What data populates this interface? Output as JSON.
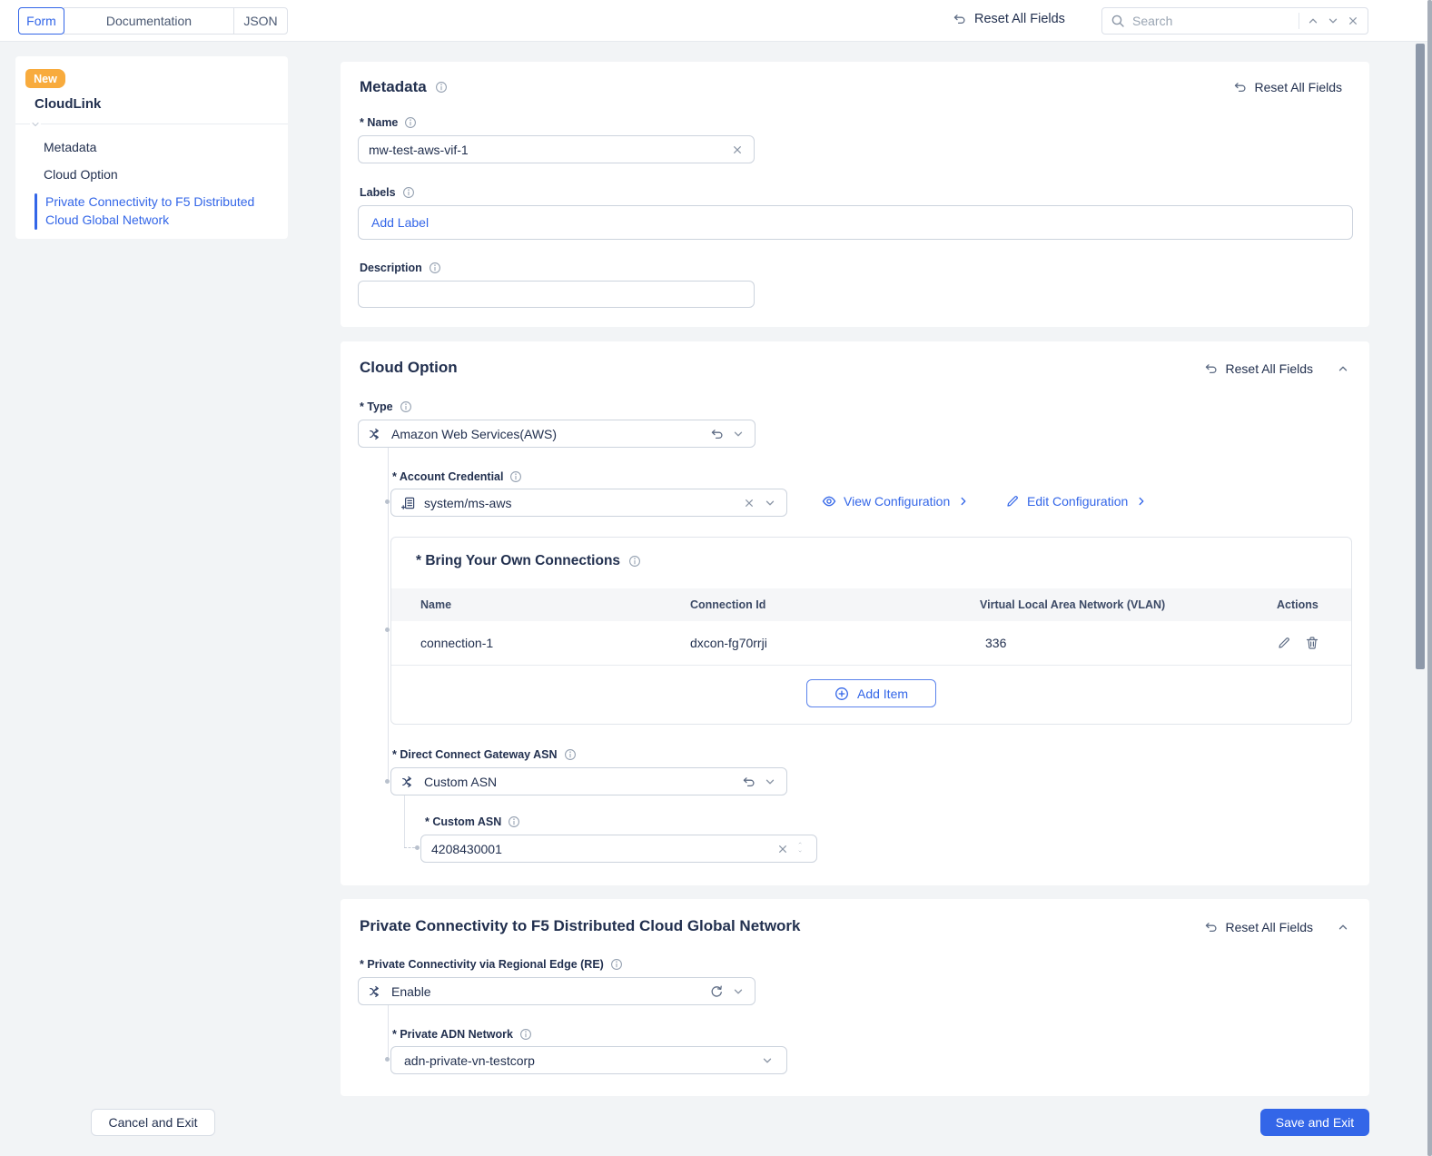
{
  "colors": {
    "accent": "#3366e8",
    "badge_orange": "#f8ab3d",
    "text_navy": "#22304f",
    "page_bg": "#f2f4f6",
    "scrollbar": "#8d98a9"
  },
  "icons": [
    "undo-icon",
    "redo-refresh-icon",
    "search-icon",
    "chevron-up-icon",
    "chevron-down-icon",
    "chevron-right-icon",
    "close-icon",
    "info-icon",
    "one-of-branch-icon",
    "reference-icon",
    "eye-icon",
    "pencil-icon",
    "trash-icon",
    "plus-circle-icon",
    "caret-notch-icon"
  ],
  "header": {
    "tabs": [
      {
        "label": "Form"
      },
      {
        "label": "Documentation"
      },
      {
        "label": "JSON"
      }
    ],
    "reset_all": "Reset All Fields",
    "search": {
      "placeholder": "Search"
    }
  },
  "sidebar": {
    "badge": "New",
    "title": "CloudLink",
    "items": [
      {
        "label": "Metadata"
      },
      {
        "label": "Cloud Option"
      },
      {
        "label": "Private Connectivity to F5 Distributed Cloud Global Network"
      }
    ]
  },
  "metadata": {
    "title": "Metadata",
    "reset_all": "Reset All Fields",
    "name_label": "* Name",
    "name_value": "mw-test-aws-vif-1",
    "labels_label": "Labels",
    "add_label": "Add Label",
    "description_label": "Description",
    "description_value": ""
  },
  "cloud_option": {
    "title": "Cloud Option",
    "reset_all": "Reset All Fields",
    "type_label": "* Type",
    "type_value": "Amazon Web Services(AWS)",
    "account_credential_label": "* Account Credential",
    "account_credential_value": "system/ms-aws",
    "view_configuration": "View Configuration",
    "edit_configuration": "Edit Configuration",
    "byoc": {
      "title": "* Bring Your Own Connections",
      "columns": [
        "Name",
        "Connection Id",
        "Virtual Local Area Network (VLAN)",
        "Actions"
      ],
      "rows": [
        {
          "name": "connection-1",
          "connection_id": "dxcon-fg70rrji",
          "vlan": "336"
        }
      ],
      "add_item": "Add Item"
    },
    "dcg_asn_label": "* Direct Connect Gateway ASN",
    "dcg_asn_value": "Custom ASN",
    "custom_asn_label": "* Custom ASN",
    "custom_asn_value": "4208430001"
  },
  "private_connectivity": {
    "title": "Private Connectivity to F5 Distributed Cloud Global Network",
    "reset_all": "Reset All Fields",
    "re_label": "* Private Connectivity via Regional Edge (RE)",
    "re_value": "Enable",
    "adn_label": "* Private ADN Network",
    "adn_value": "adn-private-vn-testcorp"
  },
  "footer": {
    "cancel": "Cancel and Exit",
    "save": "Save and Exit"
  }
}
